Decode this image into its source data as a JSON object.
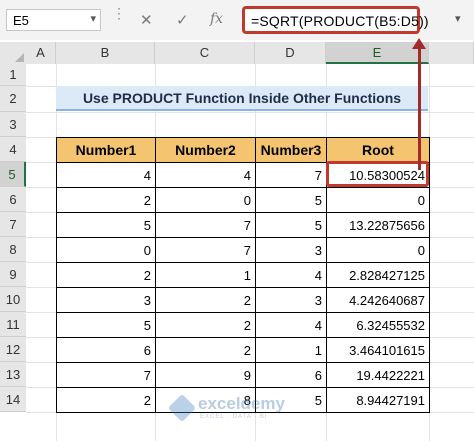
{
  "formula_bar": {
    "name_box": "E5",
    "fx_label": "fx",
    "cancel_symbol": "✕",
    "enter_symbol": "✓",
    "formula": "=SQRT(PRODUCT(B5:D5))"
  },
  "columns": [
    "A",
    "B",
    "C",
    "D",
    "E"
  ],
  "rows": [
    "1",
    "2",
    "3",
    "4",
    "5",
    "6",
    "7",
    "8",
    "9",
    "10",
    "11",
    "12",
    "13",
    "14"
  ],
  "selected_cell": {
    "column": "E",
    "row": "5"
  },
  "sheet_title": "Use PRODUCT Function Inside Other Functions",
  "table": {
    "headers": [
      "Number1",
      "Number2",
      "Number3",
      "Root"
    ],
    "rows": [
      [
        "4",
        "4",
        "7",
        "10.58300524"
      ],
      [
        "2",
        "0",
        "5",
        "0"
      ],
      [
        "5",
        "7",
        "5",
        "13.22875656"
      ],
      [
        "0",
        "7",
        "3",
        "0"
      ],
      [
        "2",
        "1",
        "4",
        "2.828427125"
      ],
      [
        "3",
        "2",
        "3",
        "4.242640687"
      ],
      [
        "5",
        "2",
        "4",
        "6.32455532"
      ],
      [
        "6",
        "2",
        "1",
        "3.464101615"
      ],
      [
        "7",
        "9",
        "6",
        "19.4422221"
      ],
      [
        "2",
        "8",
        "5",
        "8.94427191"
      ]
    ]
  },
  "colors": {
    "header_fill": "#f4c470",
    "title_fill": "#dce9f7",
    "highlight": "#c0392b",
    "accent": "#217346"
  },
  "watermark": {
    "name": "exceldemy",
    "tagline": "EXCEL · DATA · BI"
  }
}
